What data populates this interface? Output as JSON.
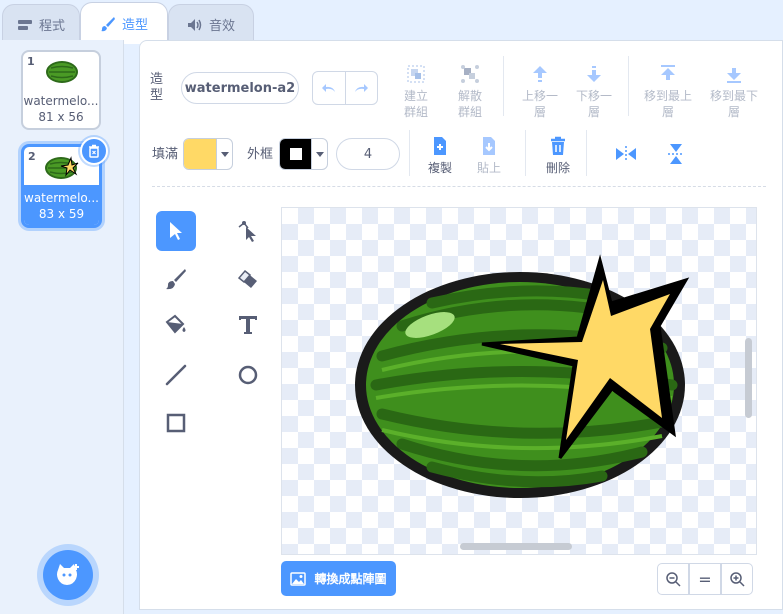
{
  "tabs": [
    {
      "label": "程式",
      "icon": "code-icon"
    },
    {
      "label": "造型",
      "icon": "brush-icon"
    },
    {
      "label": "音效",
      "icon": "speaker-icon"
    }
  ],
  "costumes": [
    {
      "number": "1",
      "name": "watermelo...",
      "size": "81 x 56"
    },
    {
      "number": "2",
      "name": "watermelo...",
      "size": "83 x 59"
    }
  ],
  "toolbar": {
    "costume_label": "造型",
    "costume_name": "watermelon-a2",
    "group": "建立群組",
    "ungroup": "解散群組",
    "forward": "上移一層",
    "backward": "下移一層",
    "front": "移到最上層",
    "back": "移到最下層",
    "fill_label": "填滿",
    "outline_label": "外框",
    "outline_width": "4",
    "copy": "複製",
    "paste": "貼上",
    "delete": "刪除"
  },
  "colors": {
    "fill": "#ffd966",
    "outline": "#000000",
    "accent": "#4c97ff"
  },
  "tools": [
    "select-tool",
    "reshape-tool",
    "brush-tool",
    "eraser-tool",
    "fill-tool",
    "text-tool",
    "line-tool",
    "circle-tool",
    "rectangle-tool"
  ],
  "canvas": {
    "convert_button": "轉換成點陣圖",
    "zoom_reset": "="
  }
}
